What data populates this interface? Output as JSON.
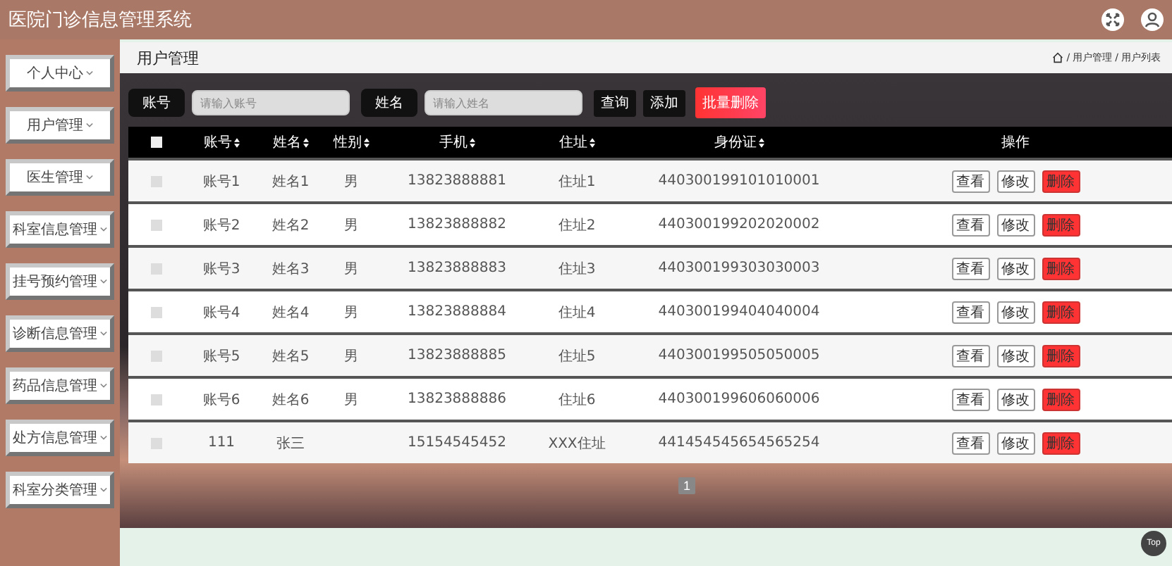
{
  "header": {
    "title": "医院门诊信息管理系统"
  },
  "sidebar": {
    "items": [
      {
        "label": "个人中心"
      },
      {
        "label": "用户管理"
      },
      {
        "label": "医生管理"
      },
      {
        "label": "科室信息管理"
      },
      {
        "label": "挂号预约管理"
      },
      {
        "label": "诊断信息管理"
      },
      {
        "label": "药品信息管理"
      },
      {
        "label": "处方信息管理"
      },
      {
        "label": "科室分类管理"
      }
    ]
  },
  "page_title": "用户管理",
  "breadcrumb": [
    {
      "separator": "/",
      "label": "用户管理"
    },
    {
      "separator": "/",
      "label": "用户列表"
    }
  ],
  "search": {
    "fields": [
      {
        "label": "账号",
        "placeholder": "请输入账号"
      },
      {
        "label": "姓名",
        "placeholder": "请输入姓名"
      }
    ],
    "buttons": [
      {
        "label": "查询",
        "kind": "dark"
      },
      {
        "label": "添加",
        "kind": "dark"
      },
      {
        "label": "批量删除",
        "kind": "danger"
      }
    ]
  },
  "table": {
    "columns": [
      {
        "label": "账号",
        "sortable": true
      },
      {
        "label": "姓名",
        "sortable": true
      },
      {
        "label": "性别",
        "sortable": true
      },
      {
        "label": "手机",
        "sortable": true
      },
      {
        "label": "住址",
        "sortable": true
      },
      {
        "label": "身份证",
        "sortable": true
      },
      {
        "label": "操作",
        "sortable": false
      }
    ],
    "all_checked": false,
    "rows": [
      {
        "checked": false,
        "cells": [
          "账号1",
          "姓名1",
          "男",
          "13823888881",
          "住址1",
          "440300199101010001"
        ],
        "actions": [
          {
            "label": "查看",
            "kind": "plain"
          },
          {
            "label": "修改",
            "kind": "plain"
          },
          {
            "label": "删除",
            "kind": "danger"
          }
        ]
      },
      {
        "checked": false,
        "cells": [
          "账号2",
          "姓名2",
          "男",
          "13823888882",
          "住址2",
          "440300199202020002"
        ],
        "actions": [
          {
            "label": "查看",
            "kind": "plain"
          },
          {
            "label": "修改",
            "kind": "plain"
          },
          {
            "label": "删除",
            "kind": "danger"
          }
        ]
      },
      {
        "checked": false,
        "cells": [
          "账号3",
          "姓名3",
          "男",
          "13823888883",
          "住址3",
          "440300199303030003"
        ],
        "actions": [
          {
            "label": "查看",
            "kind": "plain"
          },
          {
            "label": "修改",
            "kind": "plain"
          },
          {
            "label": "删除",
            "kind": "danger"
          }
        ]
      },
      {
        "checked": false,
        "cells": [
          "账号4",
          "姓名4",
          "男",
          "13823888884",
          "住址4",
          "440300199404040004"
        ],
        "actions": [
          {
            "label": "查看",
            "kind": "plain"
          },
          {
            "label": "修改",
            "kind": "plain"
          },
          {
            "label": "删除",
            "kind": "danger"
          }
        ]
      },
      {
        "checked": false,
        "cells": [
          "账号5",
          "姓名5",
          "男",
          "13823888885",
          "住址5",
          "440300199505050005"
        ],
        "actions": [
          {
            "label": "查看",
            "kind": "plain"
          },
          {
            "label": "修改",
            "kind": "plain"
          },
          {
            "label": "删除",
            "kind": "danger"
          }
        ]
      },
      {
        "checked": false,
        "cells": [
          "账号6",
          "姓名6",
          "男",
          "13823888886",
          "住址6",
          "440300199606060006"
        ],
        "actions": [
          {
            "label": "查看",
            "kind": "plain"
          },
          {
            "label": "修改",
            "kind": "plain"
          },
          {
            "label": "删除",
            "kind": "danger"
          }
        ]
      },
      {
        "checked": false,
        "cells": [
          "111",
          "张三",
          "",
          "15154545452",
          "XXX住址",
          "441454545654565254"
        ],
        "actions": [
          {
            "label": "查看",
            "kind": "plain"
          },
          {
            "label": "修改",
            "kind": "plain"
          },
          {
            "label": "删除",
            "kind": "danger"
          }
        ]
      }
    ]
  },
  "pagination": {
    "pages": [
      {
        "label": "1",
        "selected": true
      }
    ]
  },
  "top_button": "Top"
}
